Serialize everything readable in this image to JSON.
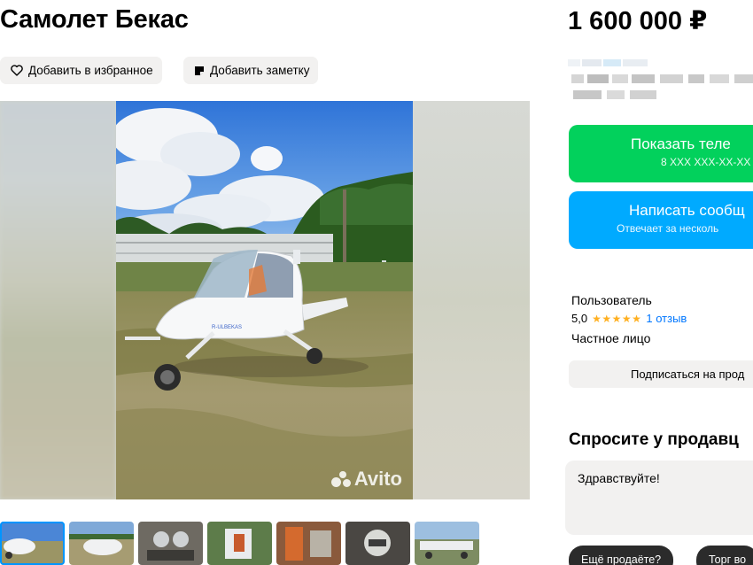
{
  "listing": {
    "title": "Самолет Бекас",
    "price": "1 600 000 ₽"
  },
  "actions": {
    "favorite_label": "Добавить в избранное",
    "note_label": "Добавить заметку"
  },
  "gallery": {
    "watermark": "Avito",
    "thumbnail_count": 7,
    "active_thumbnail": 1
  },
  "contact": {
    "show_phone_label": "Показать теле",
    "phone_mask": "8 XXX XXX-XX-XX",
    "write_label": "Написать сообщ",
    "write_sub": "Отвечает за несколь"
  },
  "seller": {
    "name": "Пользователь",
    "rating": "5,0",
    "stars": "★★★★★",
    "reviews": "1 отзыв",
    "type": "Частное лицо",
    "subscribe_label": "Подписаться на прод"
  },
  "ask": {
    "title": "Спросите у продавц",
    "message": "Здравствуйте!",
    "chips": [
      "Ещё продаёте?",
      "Торг во"
    ]
  },
  "colors": {
    "green": "#02d15c",
    "blue": "#00aaff",
    "link": "#0077ff",
    "star": "#ffb021",
    "pill_bg": "#f2f1f0"
  }
}
